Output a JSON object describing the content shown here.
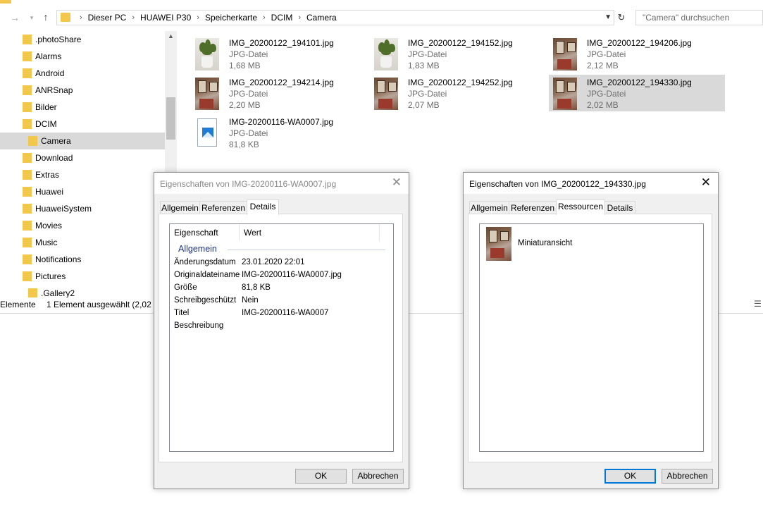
{
  "explorer": {
    "breadcrumb": [
      "Dieser PC",
      "HUAWEI P30",
      "Speicherkarte",
      "DCIM",
      "Camera"
    ],
    "search_placeholder": "\"Camera\" durchsuchen",
    "nav_items": [
      {
        "label": ".photoShare",
        "indent": 1,
        "selected": false
      },
      {
        "label": "Alarms",
        "indent": 1,
        "selected": false
      },
      {
        "label": "Android",
        "indent": 1,
        "selected": false
      },
      {
        "label": "ANRSnap",
        "indent": 1,
        "selected": false
      },
      {
        "label": "Bilder",
        "indent": 1,
        "selected": false
      },
      {
        "label": "DCIM",
        "indent": 1,
        "selected": false
      },
      {
        "label": "Camera",
        "indent": 2,
        "selected": true
      },
      {
        "label": "Download",
        "indent": 1,
        "selected": false
      },
      {
        "label": "Extras",
        "indent": 1,
        "selected": false
      },
      {
        "label": "Huawei",
        "indent": 1,
        "selected": false
      },
      {
        "label": "HuaweiSystem",
        "indent": 1,
        "selected": false
      },
      {
        "label": "Movies",
        "indent": 1,
        "selected": false
      },
      {
        "label": "Music",
        "indent": 1,
        "selected": false
      },
      {
        "label": "Notifications",
        "indent": 1,
        "selected": false
      },
      {
        "label": "Pictures",
        "indent": 1,
        "selected": false
      },
      {
        "label": ".Gallery2",
        "indent": 2,
        "selected": false
      }
    ],
    "files": [
      {
        "name": "IMG_20200122_194101.jpg",
        "type": "JPG-Datei",
        "size": "1,68 MB",
        "thumb": "plant",
        "selected": false
      },
      {
        "name": "IMG_20200122_194152.jpg",
        "type": "JPG-Datei",
        "size": "1,83 MB",
        "thumb": "plant",
        "selected": false
      },
      {
        "name": "IMG_20200122_194206.jpg",
        "type": "JPG-Datei",
        "size": "2,12 MB",
        "thumb": "room",
        "selected": false
      },
      {
        "name": "IMG_20200122_194214.jpg",
        "type": "JPG-Datei",
        "size": "2,20 MB",
        "thumb": "room",
        "selected": false
      },
      {
        "name": "IMG_20200122_194252.jpg",
        "type": "JPG-Datei",
        "size": "2,07 MB",
        "thumb": "room",
        "selected": false
      },
      {
        "name": "IMG_20200122_194330.jpg",
        "type": "JPG-Datei",
        "size": "2,02 MB",
        "thumb": "room",
        "selected": true
      },
      {
        "name": "IMG-20200116-WA0007.jpg",
        "type": "JPG-Datei",
        "size": "81,8 KB",
        "thumb": "doc",
        "selected": false
      }
    ],
    "status_count": "Elemente",
    "status_selection": "1 Element ausgewählt (2,02 MB)"
  },
  "dialog_left": {
    "title": "Eigenschaften von IMG-20200116-WA0007.jpg",
    "close_glyph": "✕",
    "tabs": [
      "Allgemein",
      "Referenzen",
      "Details"
    ],
    "active_tab": "Details",
    "col_property": "Eigenschaft",
    "col_value": "Wert",
    "group": "Allgemein",
    "properties": [
      {
        "name": "Änderungsdatum",
        "value": "23.01.2020 22:01"
      },
      {
        "name": "Originaldateiname",
        "value": "IMG-20200116-WA0007.jpg"
      },
      {
        "name": "Größe",
        "value": "81,8 KB"
      },
      {
        "name": "Schreibgeschützt",
        "value": "Nein"
      },
      {
        "name": "Titel",
        "value": "IMG-20200116-WA0007"
      },
      {
        "name": "Beschreibung",
        "value": ""
      }
    ],
    "ok_label": "OK",
    "cancel_label": "Abbrechen"
  },
  "dialog_right": {
    "title": "Eigenschaften von IMG_20200122_194330.jpg",
    "close_glyph": "✕",
    "tabs": [
      "Allgemein",
      "Referenzen",
      "Ressourcen",
      "Details"
    ],
    "active_tab": "Ressourcen",
    "resource_label": "Miniaturansicht",
    "ok_label": "OK",
    "cancel_label": "Abbrechen"
  },
  "colors": {
    "folder": "#f3c64c",
    "selection": "#d9d9d9",
    "group_header": "#1e3287",
    "default_button_border": "#0078d7"
  }
}
